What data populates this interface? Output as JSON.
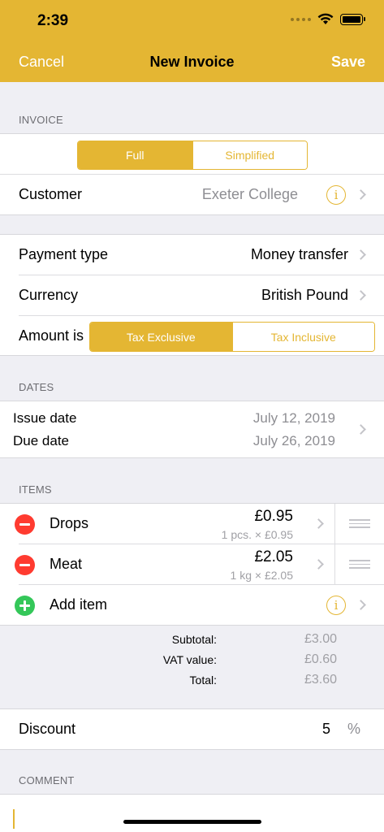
{
  "status": {
    "time": "2:39"
  },
  "nav": {
    "cancel": "Cancel",
    "title": "New Invoice",
    "save": "Save"
  },
  "invoice": {
    "header": "INVOICE",
    "type_segment": [
      "Full",
      "Simplified"
    ],
    "type_selected": "Full",
    "customer_label": "Customer",
    "customer_value": "Exeter College"
  },
  "payment": {
    "payment_type_label": "Payment type",
    "payment_type_value": "Money transfer",
    "currency_label": "Currency",
    "currency_value": "British Pound",
    "amount_label": "Amount is",
    "amount_segment": [
      "Tax Exclusive",
      "Tax Inclusive"
    ],
    "amount_selected": "Tax Exclusive"
  },
  "dates": {
    "header": "DATES",
    "issue_label": "Issue date",
    "issue_value": "July 12, 2019",
    "due_label": "Due date",
    "due_value": "July 26, 2019"
  },
  "items": {
    "header": "ITEMS",
    "list": [
      {
        "name": "Drops",
        "price": "£0.95",
        "detail": "1 pcs. × £0.95"
      },
      {
        "name": "Meat",
        "price": "£2.05",
        "detail": "1 kg × £2.05"
      }
    ],
    "add_label": "Add item"
  },
  "totals": {
    "subtotal_label": "Subtotal:",
    "subtotal_value": "£3.00",
    "vat_label": "VAT value:",
    "vat_value": "£0.60",
    "total_label": "Total:",
    "total_value": "£3.60"
  },
  "discount": {
    "label": "Discount",
    "value": "5",
    "unit": "%"
  },
  "comment": {
    "header": "COMMENT"
  },
  "colors": {
    "accent": "#e4b633",
    "delete": "#ff3b30",
    "add": "#34c759"
  }
}
